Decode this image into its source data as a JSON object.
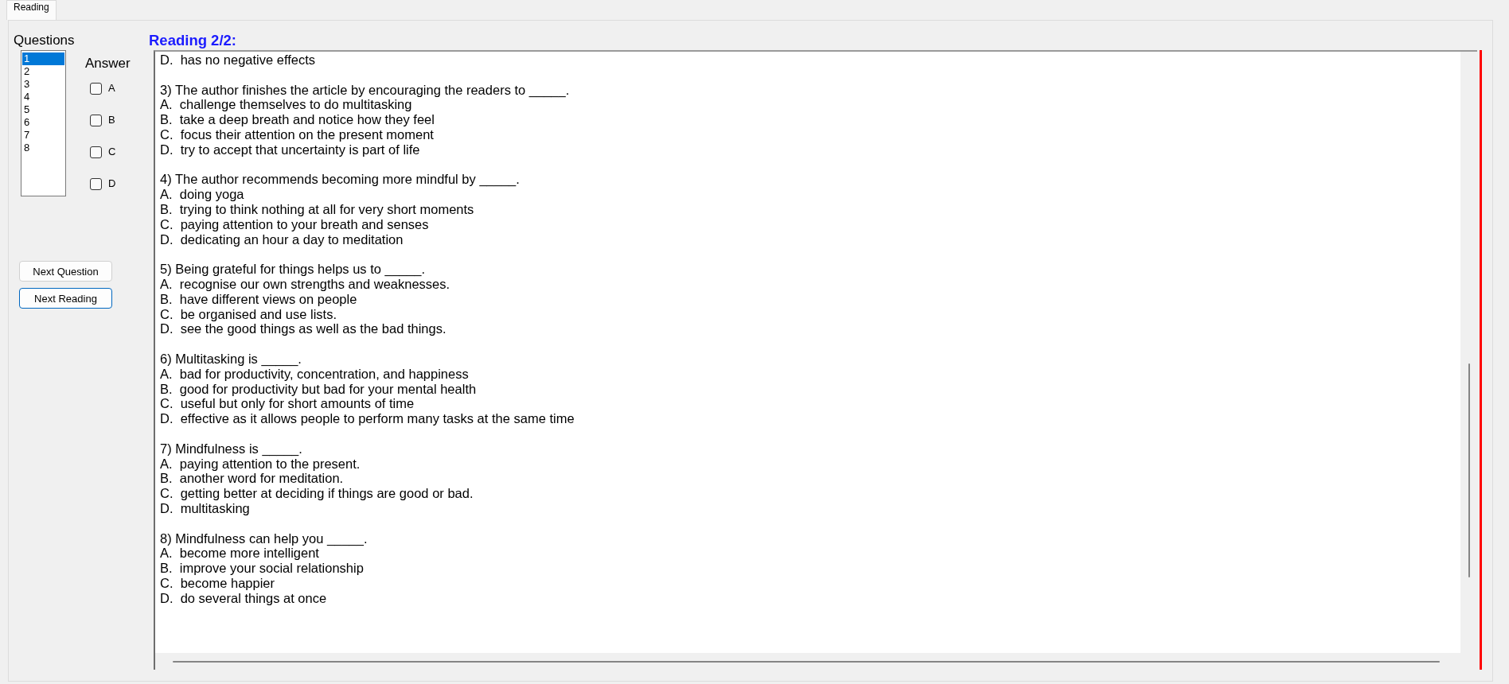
{
  "tabs": [
    {
      "label": "Reading",
      "selected": true
    }
  ],
  "questions_panel": {
    "label": "Questions",
    "items": [
      {
        "label": "1",
        "selected": true
      },
      {
        "label": "2",
        "selected": false
      },
      {
        "label": "3",
        "selected": false
      },
      {
        "label": "4",
        "selected": false
      },
      {
        "label": "5",
        "selected": false
      },
      {
        "label": "6",
        "selected": false
      },
      {
        "label": "7",
        "selected": false
      },
      {
        "label": "8",
        "selected": false
      }
    ]
  },
  "answer": {
    "label": "Answer",
    "options": [
      {
        "label": "A",
        "checked": false
      },
      {
        "label": "B",
        "checked": false
      },
      {
        "label": "C",
        "checked": false
      },
      {
        "label": "D",
        "checked": false
      }
    ]
  },
  "buttons": [
    {
      "label": "Next Question",
      "focused": false
    },
    {
      "label": "Next Reading",
      "focused": true
    }
  ],
  "reading": {
    "title": "Reading 2/2:",
    "blocks": [
      {
        "options": [
          "D.  has no negative effects"
        ]
      },
      {
        "stem": "3) The author finishes the article by encouraging the readers to _____.",
        "options": [
          "A.  challenge themselves to do multitasking",
          "B.  take a deep breath and notice how they feel",
          "C.  focus their attention on the present moment",
          "D.  try to accept that uncertainty is part of life"
        ]
      },
      {
        "stem": "4) The author recommends becoming more mindful by _____.",
        "options": [
          "A.  doing yoga",
          "B.  trying to think nothing at all for very short moments",
          "C.  paying attention to your breath and senses",
          "D.  dedicating an hour a day to meditation"
        ]
      },
      {
        "stem": "5) Being grateful for things helps us to _____.",
        "options": [
          "A.  recognise our own strengths and weaknesses.",
          "B.  have different views on people",
          "C.  be organised and use lists.",
          "D.  see the good things as well as the bad things."
        ]
      },
      {
        "stem": "6) Multitasking is _____.",
        "options": [
          "A.  bad for productivity, concentration, and happiness",
          "B.  good for productivity but bad for your mental health",
          "C.  useful but only for short amounts of time",
          "D.  effective as it allows people to perform many tasks at the same time"
        ]
      },
      {
        "stem": "7) Mindfulness is _____.",
        "options": [
          "A.  paying attention to the present.",
          "B.  another word for meditation.",
          "C.  getting better at deciding if things are good or bad.",
          "D.  multitasking"
        ]
      },
      {
        "stem": "8) Mindfulness can help you _____.",
        "options": [
          "A.  become more intelligent",
          "B.  improve your social relationship",
          "C.  become happier",
          "D.  do several things at once"
        ]
      }
    ]
  }
}
